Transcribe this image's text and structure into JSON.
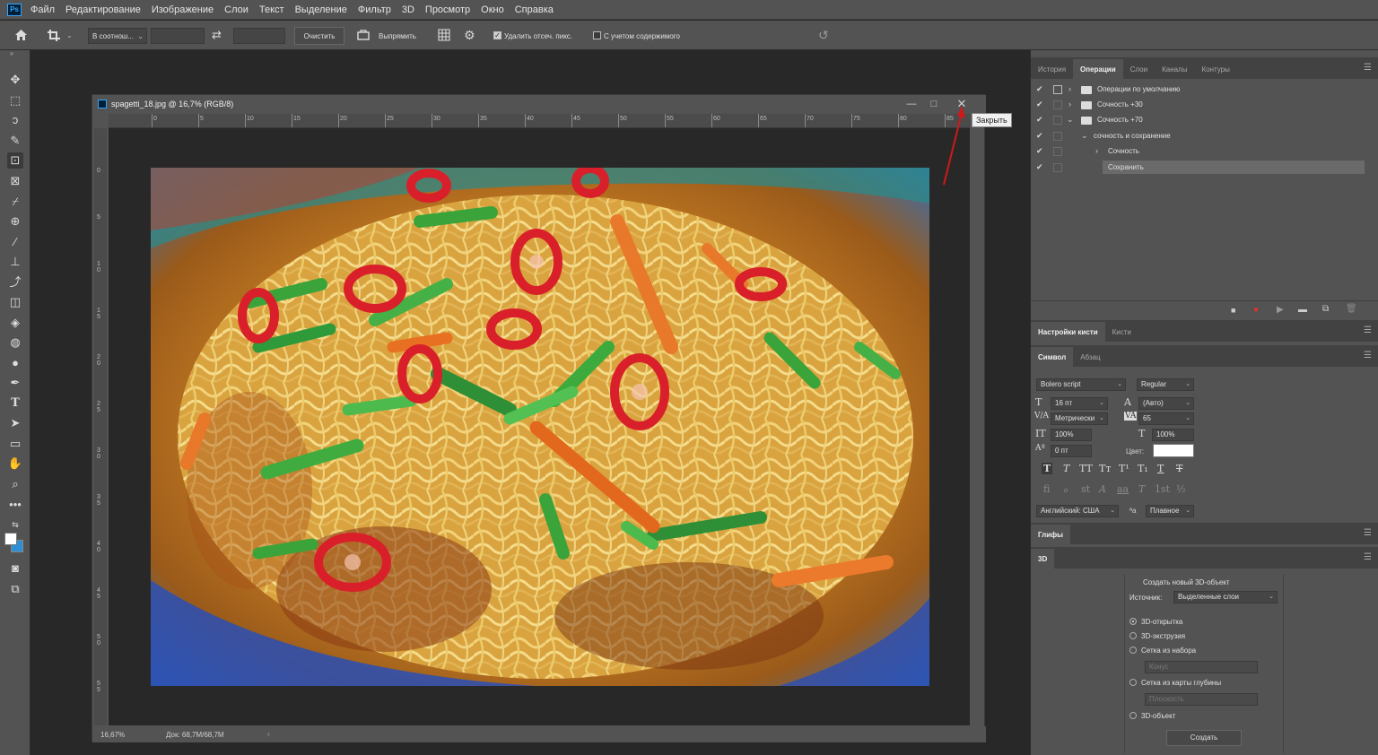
{
  "menubar": {
    "logo": "Ps",
    "items": [
      "Файл",
      "Редактирование",
      "Изображение",
      "Слои",
      "Текст",
      "Выделение",
      "Фильтр",
      "3D",
      "Просмотр",
      "Окно",
      "Справка"
    ]
  },
  "options": {
    "ratio": "В соотнош...",
    "clear": "Очистить",
    "straighten": "Выпрямить",
    "delete_cropped": "Удалить отсеч. пикс.",
    "content_aware": "С учетом содержимого"
  },
  "document": {
    "title": "spagetti_18.jpg @ 16,7% (RGB/8)",
    "zoom": "16,67%",
    "doc_size": "Док: 68,7M/68,7M",
    "ruler_h": [
      "0",
      "5",
      "10",
      "15",
      "20",
      "25",
      "30",
      "35",
      "40",
      "45",
      "50",
      "55",
      "60",
      "65",
      "70",
      "75",
      "80",
      "85"
    ],
    "ruler_v": [
      "0",
      "5",
      "1 0",
      "1 5",
      "2 0",
      "2 5",
      "3 0",
      "3 5",
      "4 0",
      "4 5",
      "5 0",
      "5 5"
    ],
    "tooltip": "Закрыть"
  },
  "actions_panel": {
    "tabs": [
      "История",
      "Операции",
      "Слои",
      "Каналы",
      "Контуры"
    ],
    "rows": [
      {
        "label": "Операции по умолчанию",
        "indent": 0,
        "expanded": false
      },
      {
        "label": "Сочность +30",
        "indent": 0,
        "expanded": false
      },
      {
        "label": "Сочность +70",
        "indent": 0,
        "expanded": true
      },
      {
        "label": "сочность и сохранение",
        "indent": 1,
        "expanded": true
      },
      {
        "label": "Сочность",
        "indent": 2,
        "expanded": false
      },
      {
        "label": "Сохранить",
        "indent": 2,
        "selected": true
      }
    ]
  },
  "brush_panel": {
    "tabs": [
      "Настройки кисти",
      "Кисти"
    ]
  },
  "char_panel": {
    "tabs": [
      "Символ",
      "Абзац"
    ],
    "font_family": "Bolero script",
    "font_style": "Regular",
    "size": "16 пт",
    "leading": "(Авто)",
    "kerning": "Метрически",
    "tracking": "65",
    "v_scale": "100%",
    "h_scale": "100%",
    "baseline": "0 пт",
    "color_label": "Цвет:",
    "language": "Английский: США",
    "antialias": "Плавное"
  },
  "glyphs_panel": {
    "title": "Глифы"
  },
  "panel3d": {
    "title": "3D",
    "heading": "Создать новый 3D-объект",
    "source_label": "Источник:",
    "source_value": "Выделенные слои",
    "options": [
      "3D-открытка",
      "3D-экструзия",
      "Сетка из набора",
      "Сетка из карты глубины",
      "3D-объект"
    ],
    "preset_placeholder": "Конус",
    "depth_placeholder": "Плоскость",
    "create_button": "Создать"
  }
}
